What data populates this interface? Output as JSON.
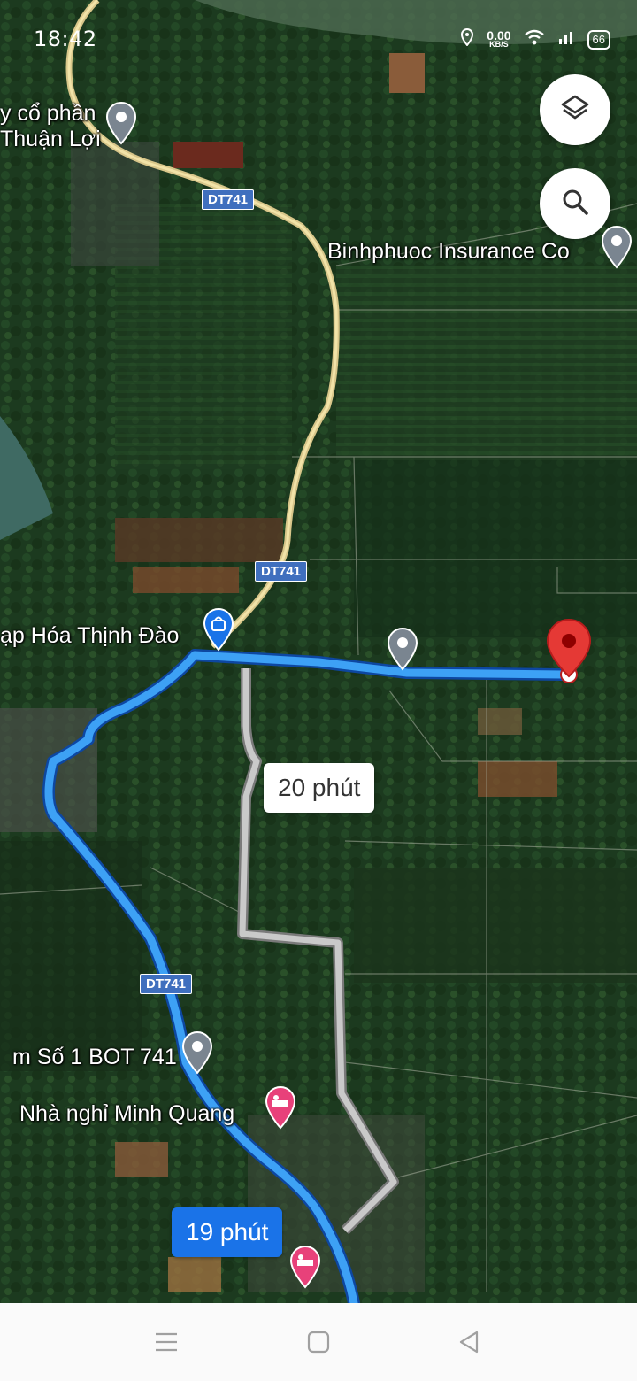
{
  "status_bar": {
    "time": "18:42",
    "speed_value": "0.00",
    "speed_unit": "KB/S",
    "battery": "66"
  },
  "map_labels": {
    "company_top_line1": "y cổ phần",
    "company_top_line2": "Thuận Lợi",
    "insurance": "Binhphuoc Insurance Co",
    "grocery": "ạp Hóa Thịnh Đào",
    "toll_station": "m Số 1 BOT 741",
    "motel": "Nhà nghỉ Minh Quang"
  },
  "road_shields": {
    "top": "DT741",
    "middle": "DT741",
    "bottom": "DT741"
  },
  "routes": {
    "alternate_time": "20 phút",
    "main_time": "19 phút"
  },
  "colors": {
    "route_main": "#1a73e8",
    "route_alt": "#b8b8b8",
    "destination_pin": "#e53935",
    "poi_pin": "#7a8590",
    "shop_pin": "#1a73e8",
    "hotel_pin": "#e8417a"
  },
  "icons": {
    "layers": "layers-icon",
    "search": "search-icon",
    "menu": "recent-apps-icon",
    "home": "home-icon",
    "back": "back-icon"
  }
}
